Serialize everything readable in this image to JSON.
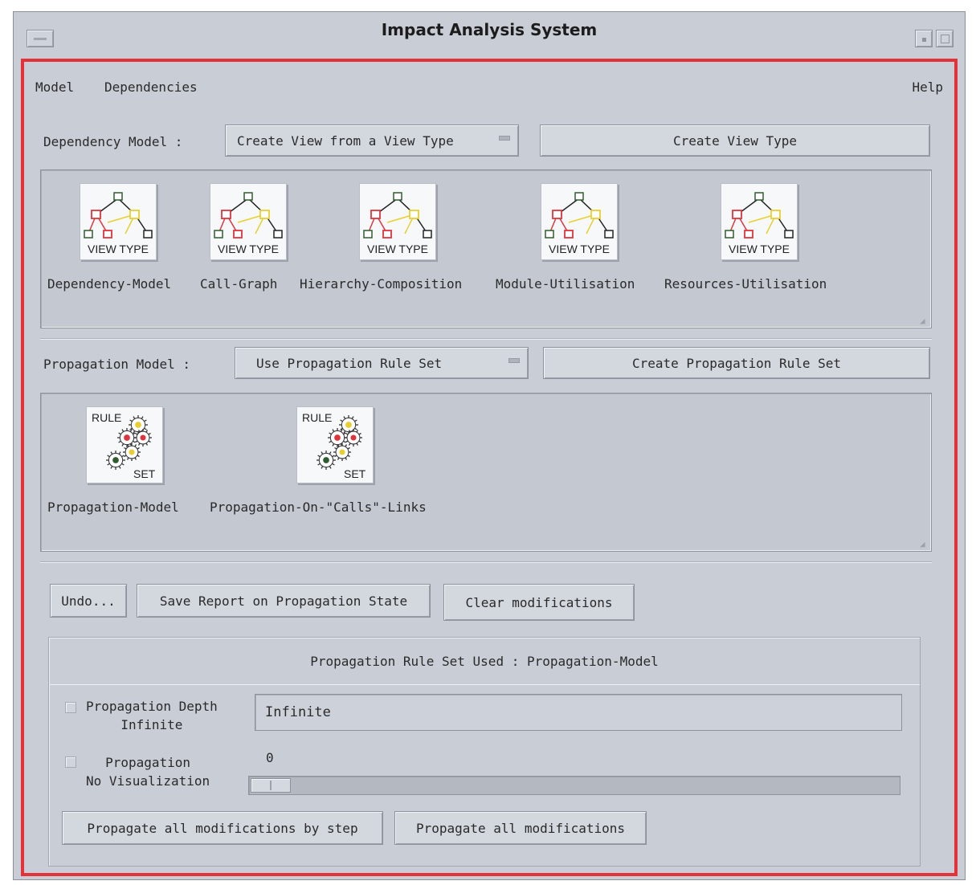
{
  "window": {
    "title": "Impact Analysis System"
  },
  "menubar": {
    "model": "Model",
    "dependencies": "Dependencies",
    "help": "Help"
  },
  "dependency": {
    "label": "Dependency Model :",
    "option_value": "Create View from a View Type",
    "create_button": "Create View Type",
    "icons": [
      {
        "label": "Dependency-Model",
        "caption": "VIEW TYPE",
        "icon": "view-type-graph-icon"
      },
      {
        "label": "Call-Graph",
        "caption": "VIEW TYPE",
        "icon": "view-type-graph-icon"
      },
      {
        "label": "Hierarchy-Composition",
        "caption": "VIEW TYPE",
        "icon": "view-type-graph-icon"
      },
      {
        "label": "Module-Utilisation",
        "caption": "VIEW TYPE",
        "icon": "view-type-graph-icon"
      },
      {
        "label": "Resources-Utilisation",
        "caption": "VIEW TYPE",
        "icon": "view-type-graph-icon"
      }
    ]
  },
  "propagation": {
    "label": "Propagation Model :",
    "option_value": "Use Propagation Rule Set",
    "create_button": "Create Propagation Rule Set",
    "icons": [
      {
        "label": "Propagation-Model",
        "caption_top": "RULE",
        "caption_bottom": "SET",
        "icon": "rule-set-gears-icon"
      },
      {
        "label": "Propagation-On-\"Calls\"-Links",
        "caption_top": "RULE",
        "caption_bottom": "SET",
        "icon": "rule-set-gears-icon"
      }
    ]
  },
  "actions": {
    "undo": "Undo...",
    "save_report": "Save Report on Propagation State",
    "clear": "Clear modifications"
  },
  "status": {
    "rule_set_used": "Propagation Rule Set Used : Propagation-Model",
    "depth_label_line1": "Propagation Depth",
    "depth_label_line2": "Infinite",
    "depth_value": "Infinite",
    "vis_label_line1": "Propagation",
    "vis_label_line2": "No Visualization",
    "slider_value": "0",
    "slider_fraction": 0
  },
  "propagate": {
    "by_step": "Propagate all modifications by step",
    "all": "Propagate all modifications"
  },
  "colors": {
    "frame": "#e5323a",
    "node_red": "#e0343c",
    "node_yellow": "#e8cf2e",
    "node_green": "#2f5c2f"
  }
}
